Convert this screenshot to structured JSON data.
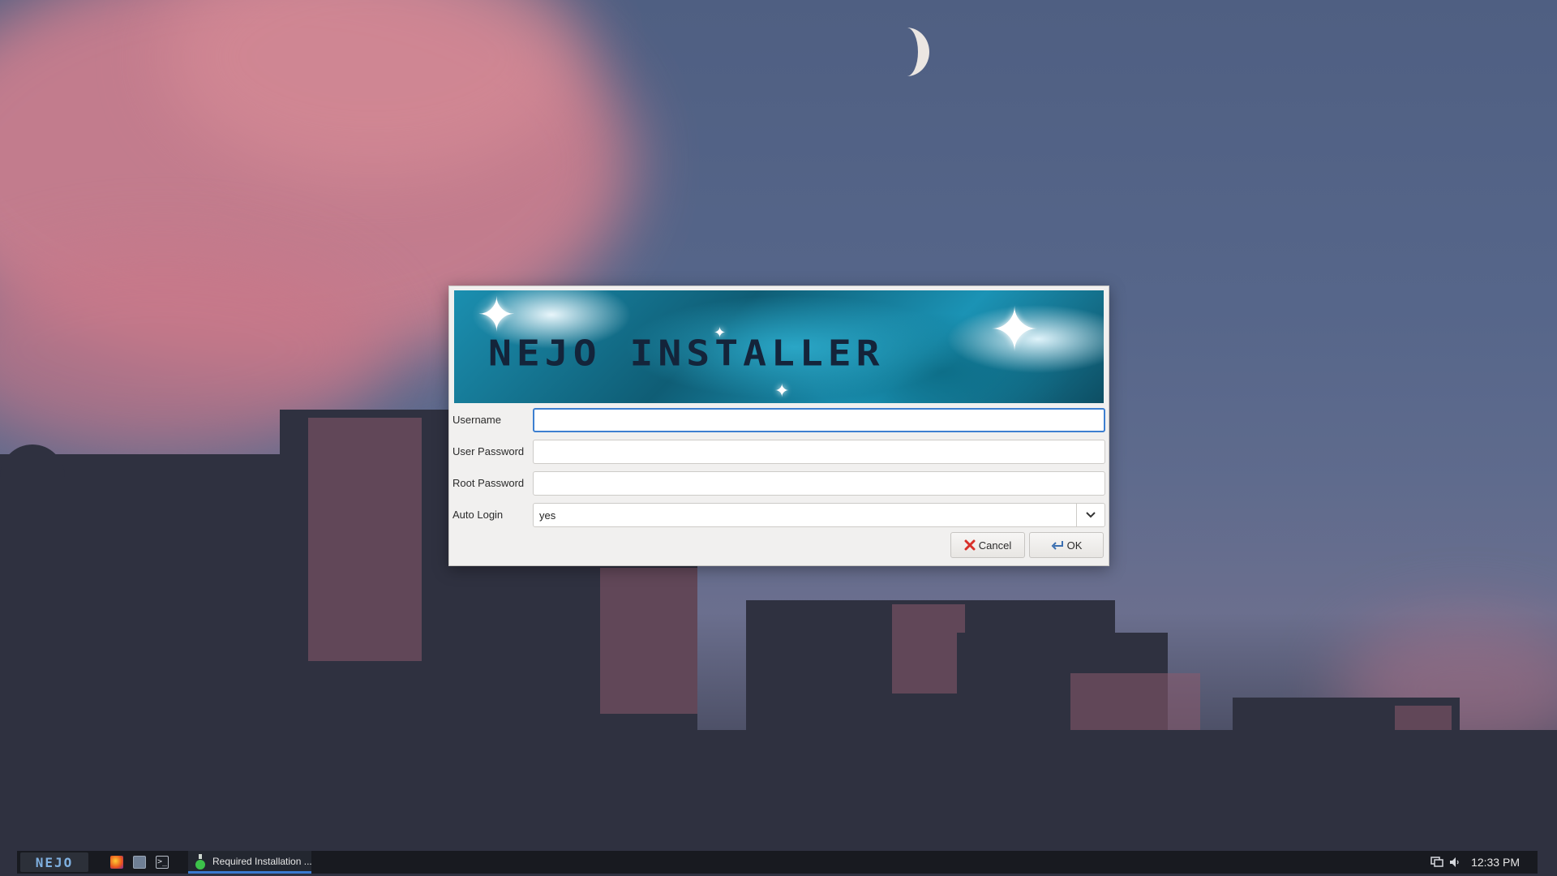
{
  "dialog": {
    "banner_title": "NEJO INSTALLER",
    "fields": [
      {
        "label": "Username",
        "value": "",
        "focused": true
      },
      {
        "label": "User Password",
        "value": ""
      },
      {
        "label": "Root Password",
        "value": ""
      }
    ],
    "auto_login": {
      "label": "Auto Login",
      "value": "yes"
    },
    "cancel_label": "Cancel",
    "ok_label": "OK"
  },
  "taskbar": {
    "start_label": "NEJO",
    "launchers": [
      "firefox-icon",
      "file-manager-icon",
      "terminal-icon"
    ],
    "task_label": "Required Installation ...",
    "tray_icons": [
      "network-icon",
      "volume-icon"
    ],
    "clock": "12:33 PM"
  },
  "colors": {
    "accent": "#3d7fd0",
    "taskbar_bg": "#181a20",
    "dialog_bg": "#f1f0ef"
  }
}
